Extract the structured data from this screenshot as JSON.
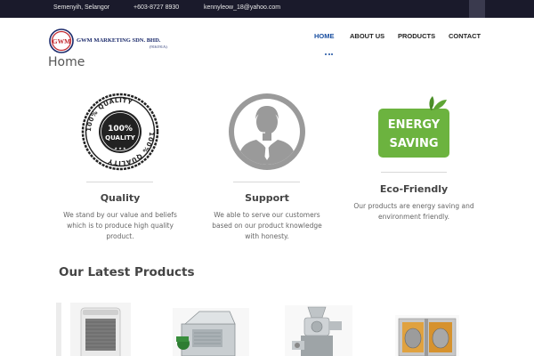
{
  "topbar": {
    "location": "Semenyih, Selangor",
    "phone": "+603-8727 8930",
    "email": "kennyleow_18@yahoo.com"
  },
  "header": {
    "logo_badge": "GWM",
    "company_name": "GWM MARKETING SDN. BHD.",
    "company_reg": "(916191A)",
    "nav": [
      {
        "label": "HOME",
        "active": true
      },
      {
        "label": "ABOUT US",
        "active": false
      },
      {
        "label": "PRODUCTS",
        "active": false
      },
      {
        "label": "CONTACT",
        "active": false
      }
    ]
  },
  "page": {
    "title": "Home"
  },
  "features": [
    {
      "icon": "quality-stamp-icon",
      "stamp_center": "100% QUALITY",
      "stamp_ring": "100% QUALITY",
      "title": "Quality",
      "desc_lines": [
        "We stand by our value and beliefs",
        "which is to produce high quality",
        "product."
      ]
    },
    {
      "icon": "support-agent-icon",
      "title": "Support",
      "desc_lines": [
        "We able to serve our customers",
        "based on our product knowledge",
        "with honesty."
      ]
    },
    {
      "icon": "energy-saving-icon",
      "badge_lines": [
        "ENERGY",
        "SAVING"
      ],
      "title": "Eco-Friendly",
      "desc_lines": [
        "Our products are energy saving and",
        "environment friendly."
      ]
    }
  ],
  "latest_products": {
    "heading": "Our Latest Products",
    "items": [
      {
        "icon": "air-cooler-product-image"
      },
      {
        "icon": "slicer-machine-product-image"
      },
      {
        "icon": "grinder-machine-product-image"
      },
      {
        "icon": "steam-cooker-product-image"
      }
    ]
  },
  "colors": {
    "topbar_bg": "#1a1a2b",
    "nav_active": "#1a4fa0",
    "energy_green": "#6cb33f"
  }
}
